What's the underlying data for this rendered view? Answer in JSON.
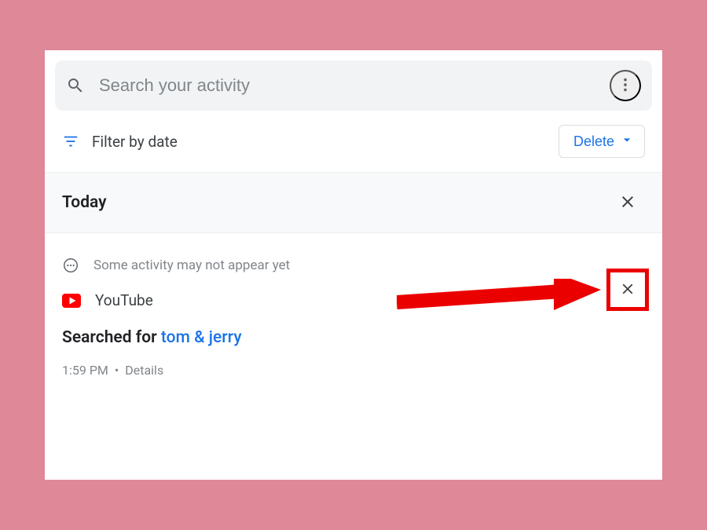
{
  "search": {
    "placeholder": "Search your activity"
  },
  "filter": {
    "label": "Filter by date"
  },
  "delete_button": {
    "label": "Delete"
  },
  "section": {
    "title": "Today"
  },
  "notice": {
    "text": "Some activity may not appear yet"
  },
  "activity_item": {
    "source": "YouTube",
    "action_prefix": "Searched for ",
    "query": "tom & jerry",
    "time": "1:59 PM",
    "separator": "•",
    "details_label": "Details"
  }
}
